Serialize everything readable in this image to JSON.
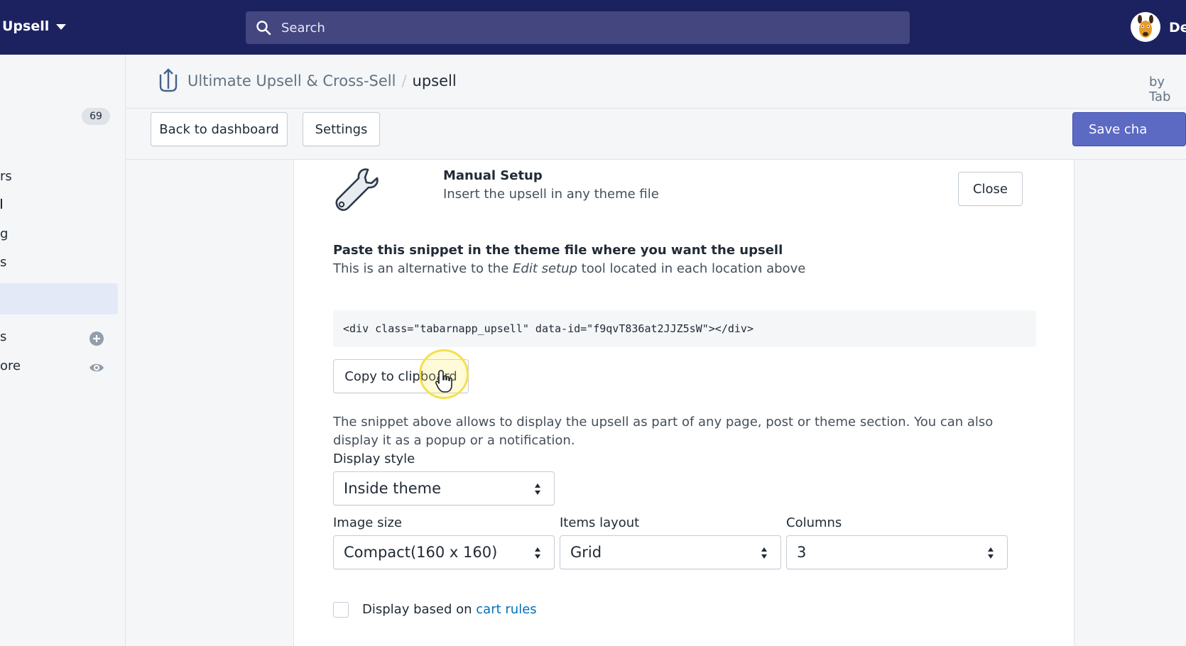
{
  "topbar": {
    "store_name": "Upsell",
    "search_placeholder": "Search",
    "user_name": "De"
  },
  "sidebar": {
    "badge_count": "69",
    "items": [
      {
        "label": "rs"
      },
      {
        "label": "s"
      },
      {
        "label": "g"
      },
      {
        "label": "s"
      },
      {
        "label": "s"
      },
      {
        "label": "ore"
      }
    ]
  },
  "header": {
    "app_name": "Ultimate Upsell & Cross-Sell",
    "separator": "/",
    "current_page": "upsell",
    "by_author": "by Tab"
  },
  "toolbar": {
    "back_label": "Back to dashboard",
    "settings_label": "Settings",
    "save_label": "Save cha"
  },
  "manual_setup": {
    "title": "Manual Setup",
    "subtitle": "Insert the upsell in any theme file",
    "close_label": "Close"
  },
  "snippet": {
    "title": "Paste this snippet in the theme file where you want the upsell",
    "sub_before": "This is an alternative to the ",
    "sub_em": "Edit setup",
    "sub_after": " tool located in each location above",
    "code": "<div class=\"tabarnapp_upsell\" data-id=\"f9qvT836at2JJZ5sW\"></div>",
    "copy_label": "Copy to clipboard",
    "description": "The snippet above allows to display the upsell as part of any page, post or theme section. You can also display it as a popup or a notification."
  },
  "form": {
    "display_style_label": "Display style",
    "display_style_value": "Inside theme",
    "image_size_label": "Image size",
    "image_size_value": "Compact(160 x 160)",
    "items_layout_label": "Items layout",
    "items_layout_value": "Grid",
    "columns_label": "Columns",
    "columns_value": "3",
    "cart_rules_prefix": "Display based on ",
    "cart_rules_link": "cart rules"
  },
  "colors": {
    "topbar": "#1c2260",
    "primary": "#5c6ac4",
    "link": "#006fbb"
  }
}
